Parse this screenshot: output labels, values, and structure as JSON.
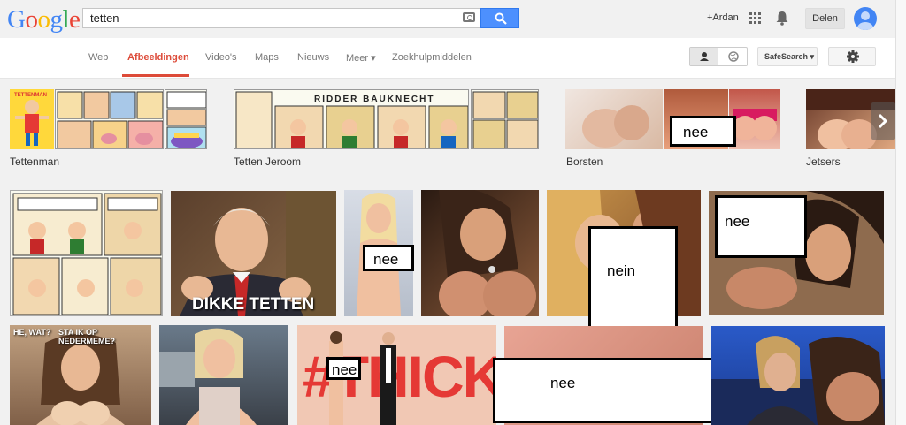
{
  "logo": {
    "text": "Google"
  },
  "search": {
    "query": "tetten"
  },
  "header": {
    "ardan": "+Ardan",
    "share": "Delen"
  },
  "tabs": [
    {
      "label": "Web"
    },
    {
      "label": "Afbeeldingen"
    },
    {
      "label": "Video's"
    },
    {
      "label": "Maps"
    },
    {
      "label": "Nieuws"
    },
    {
      "label": "Meer ▾"
    },
    {
      "label": "Zoekhulpmiddelen"
    }
  ],
  "tools": {
    "safesearch": "SafeSearch ▾"
  },
  "related": [
    {
      "label": "Tettenman",
      "tag": "TETTENMAN"
    },
    {
      "label": "Tetten Jeroom",
      "tag": "RIDDER BAUKNECHT"
    },
    {
      "label": "Borsten"
    },
    {
      "label": "Jetsers"
    }
  ],
  "redactions": {
    "nee": "nee",
    "nein": "nein"
  },
  "captions": {
    "dikke": "DIKKE TETTEN",
    "hewat": "HE, WAT?",
    "sta": "STA IK OP NEDERMEME?",
    "thicke": "#THICKE"
  },
  "colors": {
    "accent": "#dd4b39",
    "search_button": "#4d90fe"
  }
}
